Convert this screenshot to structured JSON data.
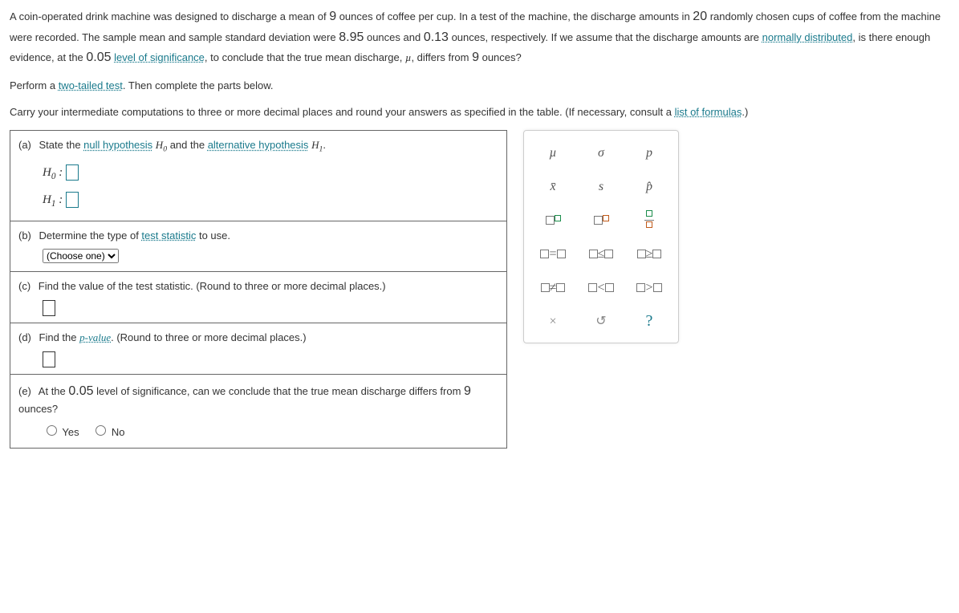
{
  "problem": {
    "p1a": "A coin-operated drink machine was designed to discharge a mean of ",
    "v1": "9",
    "p1b": " ounces of coffee per cup. In a test of the machine, the discharge amounts in ",
    "v2": "20",
    "p1c": " randomly chosen cups of coffee from the machine were recorded. The sample mean and sample standard deviation were ",
    "v3": "8.95",
    "p1d": " ounces and ",
    "v4": "0.13",
    "p1e": " ounces, respectively. If we assume that the discharge amounts are ",
    "link1": "normally distributed",
    "p1f": ", is there enough evidence, at the ",
    "v5": "0.05",
    "space": " ",
    "link2": "level of significance",
    "p1g": ", to conclude that the true mean discharge, ",
    "mu": "µ",
    "p1h": ", differs from ",
    "v6": "9",
    "p1i": " ounces?",
    "p2a": "Perform a ",
    "link3": "two-tailed test",
    "p2b": ". Then complete the parts below.",
    "p3a": "Carry your intermediate computations to three or more decimal places and round your answers as specified in the table. (If necessary, consult a ",
    "link4": "list of formulas",
    "p3b": ".)"
  },
  "parts": {
    "a": {
      "label": "(a)",
      "text1": "State the ",
      "link1": "null hypothesis",
      "text2": " and the ",
      "link2": "alternative hypothesis",
      "period": ".",
      "h0": "H",
      "h0sub": "0",
      "h1": "H",
      "h1sub": "1"
    },
    "b": {
      "label": "(b)",
      "text": "Determine the type of ",
      "link": "test statistic",
      "text2": " to use.",
      "choose": "(Choose one)"
    },
    "c": {
      "label": "(c)",
      "text": "Find the value of the test statistic. (Round to three or more decimal places.)"
    },
    "d": {
      "label": "(d)",
      "text1": "Find the ",
      "link": "p-value",
      "text2": ". (Round to three or more decimal places.)"
    },
    "e": {
      "label": "(e)",
      "text1": "At the ",
      "val": "0.05",
      "text2": " level of significance, can we conclude that the true mean discharge differs from ",
      "val2": "9",
      "text3": " ounces?",
      "yes": "Yes",
      "no": "No"
    }
  },
  "palette": {
    "r1": {
      "a": "µ",
      "b": "σ",
      "c": "p"
    },
    "r2": {
      "a": "x̄",
      "b": "s",
      "c": "p̂"
    },
    "r4": {
      "a": "=",
      "b": "≤",
      "c": "≥"
    },
    "r5": {
      "a": "≠",
      "b": "<",
      "c": ">"
    },
    "r6": {
      "a": "×",
      "b": "↺",
      "c": "?"
    }
  }
}
